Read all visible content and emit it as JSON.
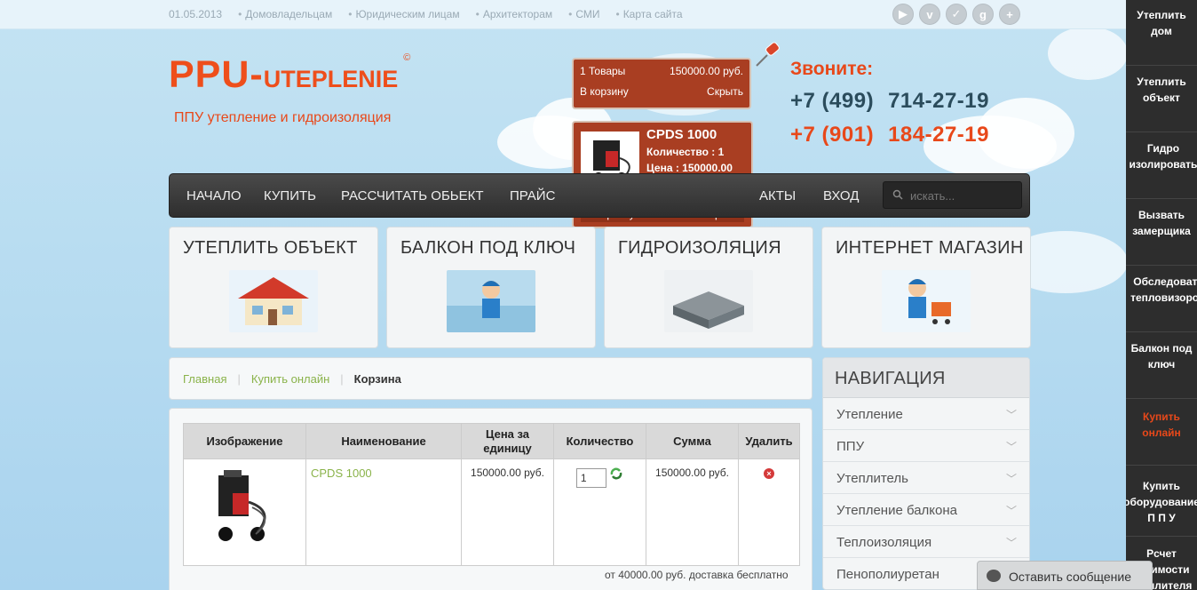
{
  "top": {
    "date": "01.05.2013",
    "links": [
      "Домовладельцам",
      "Юридическим лицам",
      "Архитекторам",
      "СМИ",
      "Карта сайта"
    ],
    "socials": [
      "youtube-icon",
      "vimeo-icon",
      "delicious-icon",
      "google-icon",
      "plus-icon"
    ],
    "social_glyphs": [
      "▶",
      "v",
      "✓",
      "g",
      "+"
    ]
  },
  "logo": {
    "part1": "PPU-",
    "part2": "UTEPLENIE",
    "mark": "©",
    "tagline": "ППУ утепление и гидроизоляция"
  },
  "cart": {
    "count": "1 Товары",
    "total": "150000.00 руб.",
    "to_cart": "В корзину",
    "hide": "Скрыть"
  },
  "popup": {
    "title": "CPDS 1000",
    "qty": "Количество : 1",
    "price": "Цена : 150000.00 руб.",
    "to_cart": "В корзину",
    "close": "Закрыть"
  },
  "contacts": {
    "call": "Звоните:",
    "phone1_code": "+7 (499)",
    "phone1_num": "714-27-19",
    "phone2_code": "+7 (901)",
    "phone2_num": "184-27-19"
  },
  "menu": {
    "items": [
      "НАЧАЛО",
      "КУПИТЬ",
      "РАССЧИТАТЬ ОБЬЕКТ",
      "ПРАЙС",
      "АКТЫ",
      "ВХОД"
    ],
    "search_placeholder": "искать..."
  },
  "boxes": [
    "УТЕПЛИТЬ ОБЪЕКТ",
    "БАЛКОН ПОД КЛЮЧ",
    "ГИДРОИЗОЛЯЦИЯ",
    "ИНТЕРНЕТ МАГАЗИН"
  ],
  "breadcrumb": {
    "home": "Главная",
    "buy": "Купить онлайн",
    "current": "Корзина"
  },
  "table": {
    "headers": [
      "Изображение",
      "Наименование",
      "Цена за единицу",
      "Количество",
      "Сумма",
      "Удалить"
    ],
    "row": {
      "name": "CPDS 1000",
      "price": "150000.00 руб.",
      "qty": "1",
      "sum": "150000.00 руб."
    },
    "note": "от 40000.00 руб. доставка бесплатно"
  },
  "navigation": {
    "title": "НАВИГАЦИЯ",
    "items": [
      "Утепление",
      "ППУ",
      "Утеплитель",
      "Утепление балкона",
      "Теплоизоляция",
      "Пенополиуретан"
    ]
  },
  "sidebar": [
    "Утеплить дом",
    "Утеплить объект",
    "Гидро изолировать",
    "Вызвать замерщика",
    "Обследовать тепловизором",
    "Балкон под ключ",
    "Купить онлайн",
    "Купить оборудование П П У",
    "Рсчет стоимости утеплителя"
  ],
  "chat": "Оставить сообщение"
}
